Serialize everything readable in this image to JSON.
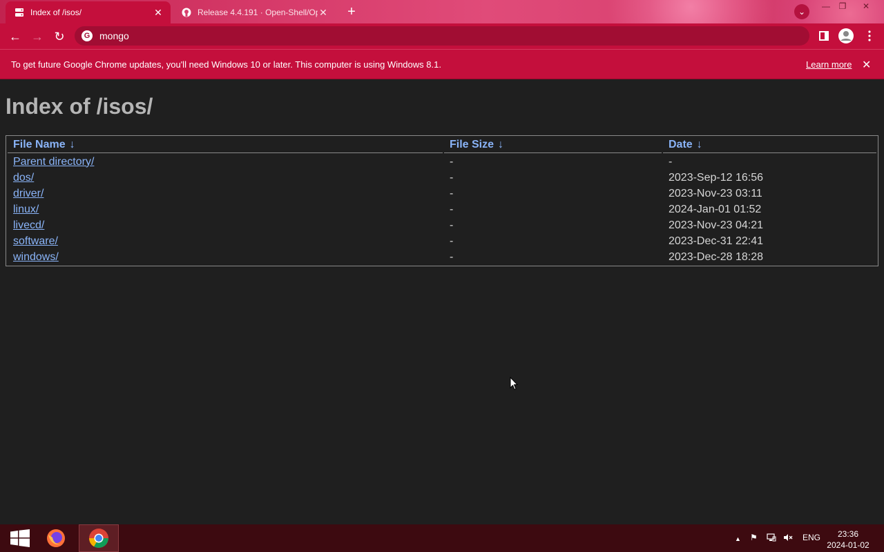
{
  "browser": {
    "tabs": [
      {
        "title": "Index of /isos/",
        "active": true,
        "favicon": "server-favicon"
      },
      {
        "title": "Release 4.4.191 · Open-Shell/Op",
        "active": false,
        "favicon": "github-favicon"
      }
    ],
    "new_tab_label": "+",
    "address": "mongo",
    "accent_color": "#c40f3c"
  },
  "infobar": {
    "message": "To get future Google Chrome updates, you'll need Windows 10 or later. This computer is using Windows 8.1.",
    "learn_more": "Learn more"
  },
  "page": {
    "heading": "Index of /isos/",
    "columns": [
      {
        "label": "File Name",
        "sort_arrow": "↓"
      },
      {
        "label": "File Size",
        "sort_arrow": "↓"
      },
      {
        "label": "Date",
        "sort_arrow": "↓"
      }
    ],
    "rows": [
      {
        "name": "Parent directory/",
        "size": "-",
        "date": "-"
      },
      {
        "name": "dos/",
        "size": "-",
        "date": "2023-Sep-12 16:56"
      },
      {
        "name": "driver/",
        "size": "-",
        "date": "2023-Nov-23 03:11"
      },
      {
        "name": "linux/",
        "size": "-",
        "date": "2024-Jan-01 01:52"
      },
      {
        "name": "livecd/",
        "size": "-",
        "date": "2023-Nov-23 04:21"
      },
      {
        "name": "software/",
        "size": "-",
        "date": "2023-Dec-31 22:41"
      },
      {
        "name": "windows/",
        "size": "-",
        "date": "2023-Dec-28 18:28"
      }
    ]
  },
  "taskbar": {
    "apps": [
      "start-button",
      "firefox",
      "chrome"
    ],
    "language": "ENG",
    "time": "23:36",
    "date": "2024-01-02"
  }
}
